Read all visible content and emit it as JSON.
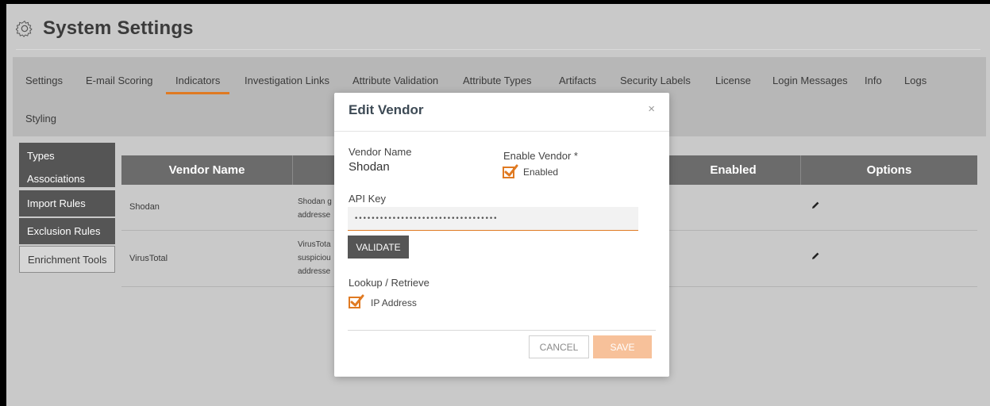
{
  "header": {
    "title": "System Settings",
    "icon": "gear-icon"
  },
  "tabs": [
    {
      "label": "Settings",
      "active": false
    },
    {
      "label": "E-mail Scoring",
      "active": false
    },
    {
      "label": "Indicators",
      "active": true
    },
    {
      "label": "Investigation Links",
      "active": false
    },
    {
      "label": "Attribute Validation",
      "active": false
    },
    {
      "label": "Attribute Types",
      "active": false
    },
    {
      "label": "Artifacts",
      "active": false
    },
    {
      "label": "Security Labels",
      "active": false
    },
    {
      "label": "License",
      "active": false
    },
    {
      "label": "Login Messages",
      "active": false
    },
    {
      "label": "Info",
      "active": false
    },
    {
      "label": "Logs",
      "active": false
    },
    {
      "label": "Styling",
      "active": false
    }
  ],
  "sidemenu": [
    {
      "label": "Types"
    },
    {
      "label": "Associations"
    },
    {
      "label": "Import Rules"
    },
    {
      "label": "Exclusion Rules"
    },
    {
      "label": "Enrichment Tools",
      "selected": true
    }
  ],
  "table": {
    "columns": [
      "Vendor Name",
      "Enabled",
      "Options"
    ],
    "rows": [
      {
        "vendor": "Shodan",
        "description_lines": [
          "Shodan g",
          "addresse"
        ]
      },
      {
        "vendor": "VirusTotal",
        "description_lines": [
          "VirusTota",
          "suspiciou",
          "addresse"
        ]
      }
    ]
  },
  "modal": {
    "title": "Edit Vendor",
    "close": "×",
    "vendor_name_label": "Vendor Name",
    "vendor_name_value": "Shodan",
    "enable_vendor_label": "Enable Vendor *",
    "enabled_label": "Enabled",
    "enabled_checked": true,
    "api_key_label": "API Key",
    "api_key_value": "••••••••••••••••••••••••••••••••••",
    "validate_label": "VALIDATE",
    "lookup_label": "Lookup / Retrieve",
    "ip_address_label": "IP Address",
    "ip_address_checked": true,
    "cancel_label": "CANCEL",
    "save_label": "SAVE"
  },
  "colors": {
    "accent": "#e07a22",
    "save_disabled": "#f7c19a",
    "dark_button": "#555555"
  }
}
